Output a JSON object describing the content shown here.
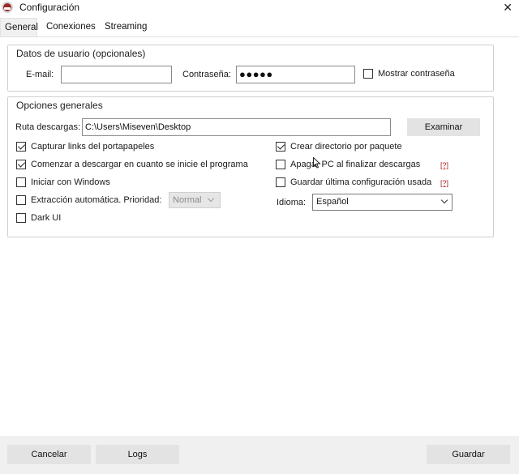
{
  "window": {
    "title": "Configuración",
    "close_glyph": "✕"
  },
  "tabs": [
    {
      "label": "General",
      "active": true
    },
    {
      "label": "Conexiones",
      "active": false
    },
    {
      "label": "Streaming",
      "active": false
    }
  ],
  "user_group": {
    "title": "Datos de usuario (opcionales)",
    "email_label": "E-mail:",
    "email_value": "",
    "password_label": "Contraseña:",
    "password_value": "●●●●●",
    "show_password_label": "Mostrar contraseña",
    "show_password_checked": false
  },
  "general_group": {
    "title": "Opciones generales",
    "path_label": "Ruta descargas:",
    "path_value": "C:\\Users\\Miseven\\Desktop",
    "browse_button": "Examinar",
    "options_left": [
      {
        "label": "Capturar links del portapapeles",
        "checked": true
      },
      {
        "label": "Comenzar a descargar en cuanto se inicie el programa",
        "checked": true
      },
      {
        "label": "Iniciar con Windows",
        "checked": false
      },
      {
        "label": "Extracción automática. Prioridad:",
        "checked": false
      },
      {
        "label": "Dark UI",
        "checked": false
      }
    ],
    "priority_value": "Normal",
    "options_right": [
      {
        "label": "Crear directorio por paquete",
        "checked": true
      },
      {
        "label": "Apagar PC al finalizar descargas",
        "checked": false,
        "help": "[?]"
      },
      {
        "label": "Guardar última configuración usada",
        "checked": false,
        "help": "[?]"
      }
    ],
    "language_label": "Idioma:",
    "language_value": "Español"
  },
  "footer": {
    "cancel_button": "Cancelar",
    "logs_button": "Logs",
    "save_button": "Guardar"
  },
  "colors": {
    "help_link": "#b01818",
    "button_bg": "#e3e3e3",
    "footer_bg": "#f0f0f0"
  }
}
